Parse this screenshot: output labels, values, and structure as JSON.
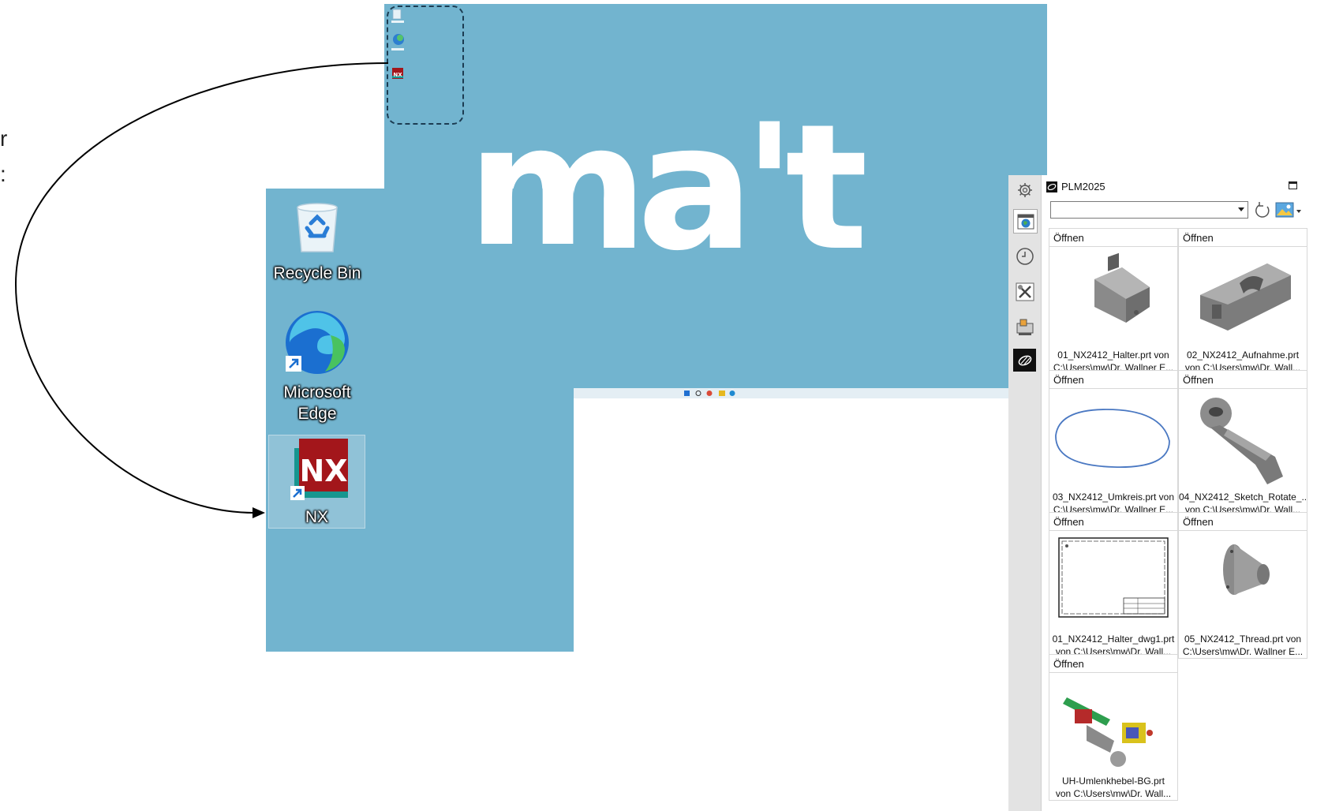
{
  "slide_edge": {
    "line1": "r",
    "line2": ":"
  },
  "thumbnail": {
    "brand_text": "ma't",
    "icons": [
      "Recycle Bin",
      "Microsoft Edge",
      "NX"
    ]
  },
  "desktop": {
    "icons": [
      {
        "label": "Recycle Bin",
        "icon": "recycle-bin-icon"
      },
      {
        "label": "Microsoft Edge",
        "icon": "edge-icon"
      },
      {
        "label": "NX",
        "icon": "nx-icon"
      }
    ]
  },
  "panel": {
    "title": "PLM2025",
    "rail_icons": [
      "gear-icon",
      "globe-browser-icon",
      "clock-history-icon",
      "tools-icon",
      "machine-tool-icon",
      "nx-resource-icon"
    ],
    "cards": [
      {
        "open": "Öffnen",
        "name": "01_NX2412_Halter.prt von",
        "path": "C:\\Users\\mw\\Dr. Wallner E..."
      },
      {
        "open": "Öffnen",
        "name": "02_NX2412_Aufnahme.prt",
        "path": "von C:\\Users\\mw\\Dr. Wall..."
      },
      {
        "open": "Öffnen",
        "name": "03_NX2412_Umkreis.prt von",
        "path": "C:\\Users\\mw\\Dr. Wallner E..."
      },
      {
        "open": "Öffnen",
        "name": "04_NX2412_Sketch_Rotate_...",
        "path": "von C:\\Users\\mw\\Dr. Wall..."
      },
      {
        "open": "Öffnen",
        "name": "01_NX2412_Halter_dwg1.prt",
        "path": "von C:\\Users\\mw\\Dr. Wall..."
      },
      {
        "open": "Öffnen",
        "name": "05_NX2412_Thread.prt von",
        "path": "C:\\Users\\mw\\Dr. Wallner E..."
      },
      {
        "open": "Öffnen",
        "name": "UH-Umlenkhebel-BG.prt",
        "path": "von C:\\Users\\mw\\Dr. Wall..."
      }
    ]
  },
  "colors": {
    "desktop_bg": "#72b4cf",
    "nx_red": "#a3161b",
    "nx_teal": "#17968f",
    "highlight_border": "#1c3c52"
  }
}
